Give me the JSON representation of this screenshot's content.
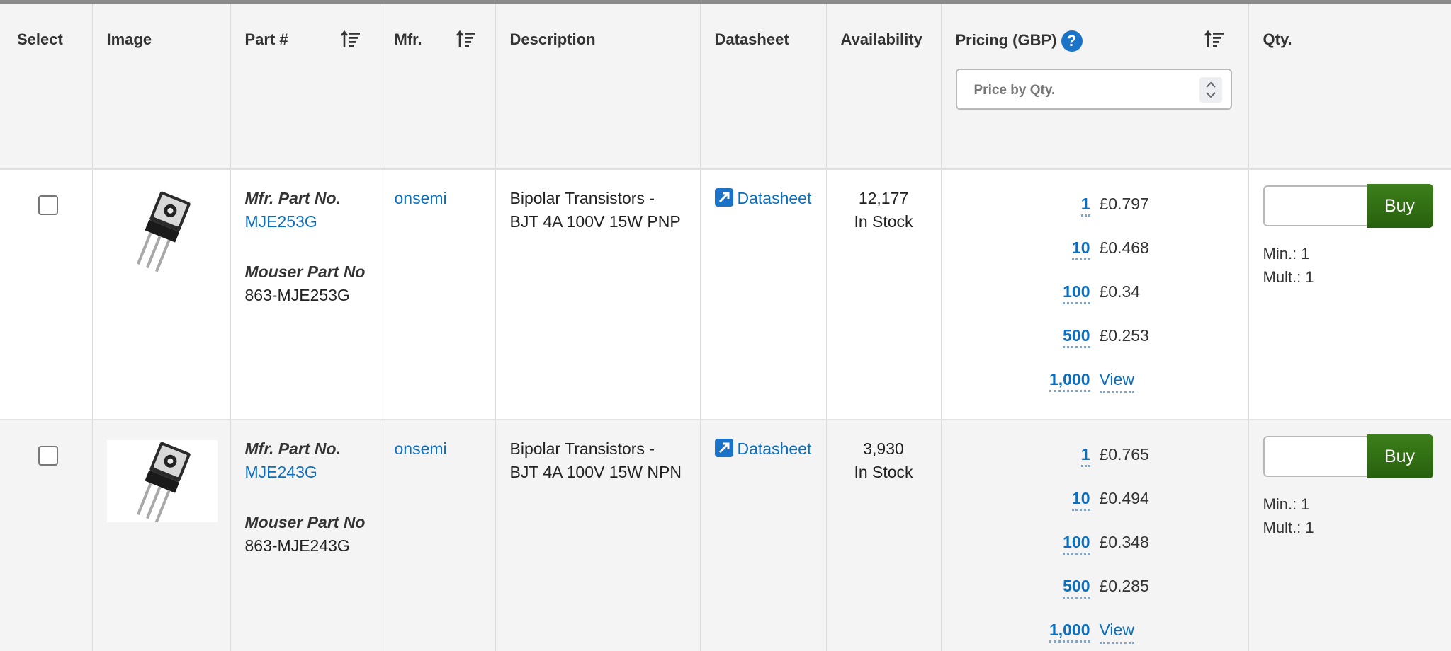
{
  "columns": {
    "select": "Select",
    "image": "Image",
    "part": "Part #",
    "mfr": "Mfr.",
    "description": "Description",
    "datasheet": "Datasheet",
    "availability": "Availability",
    "pricing": "Pricing (GBP)",
    "qty": "Qty."
  },
  "pricing_filter": {
    "placeholder": "Price by Qty."
  },
  "icons": {
    "sort": "sort-ascending-icon",
    "help": "question-mark-icon",
    "datasheet": "external-link-icon",
    "spinner": "up-down-chevron-icon"
  },
  "colors": {
    "link": "#0b6fbf",
    "buy_button": "#2f6b12",
    "help_icon": "#1a73c7"
  },
  "help_glyph": "?",
  "rows": [
    {
      "mfr_part_label": "Mfr. Part No.",
      "mfr_part_no": "MJE253G",
      "mouser_part_label": "Mouser Part No",
      "mouser_part_no": "863-MJE253G",
      "manufacturer": "onsemi",
      "description_line1": "Bipolar Transistors -",
      "description_line2": "BJT 4A 100V 15W PNP",
      "datasheet_label": "Datasheet",
      "stock_count": "12,177",
      "stock_status": "In Stock",
      "price_breaks": [
        {
          "qty": "1",
          "price": "£0.797"
        },
        {
          "qty": "10",
          "price": "£0.468"
        },
        {
          "qty": "100",
          "price": "£0.34"
        },
        {
          "qty": "500",
          "price": "£0.253"
        },
        {
          "qty": "1,000",
          "price": "View"
        }
      ],
      "buy_label": "Buy",
      "min_label": "Min.: 1",
      "mult_label": "Mult.: 1"
    },
    {
      "mfr_part_label": "Mfr. Part No.",
      "mfr_part_no": "MJE243G",
      "mouser_part_label": "Mouser Part No",
      "mouser_part_no": "863-MJE243G",
      "manufacturer": "onsemi",
      "description_line1": "Bipolar Transistors -",
      "description_line2": "BJT 4A 100V 15W NPN",
      "datasheet_label": "Datasheet",
      "stock_count": "3,930",
      "stock_status": "In Stock",
      "price_breaks": [
        {
          "qty": "1",
          "price": "£0.765"
        },
        {
          "qty": "10",
          "price": "£0.494"
        },
        {
          "qty": "100",
          "price": "£0.348"
        },
        {
          "qty": "500",
          "price": "£0.285"
        },
        {
          "qty": "1,000",
          "price": "View"
        }
      ],
      "buy_label": "Buy",
      "min_label": "Min.: 1",
      "mult_label": "Mult.: 1"
    }
  ]
}
